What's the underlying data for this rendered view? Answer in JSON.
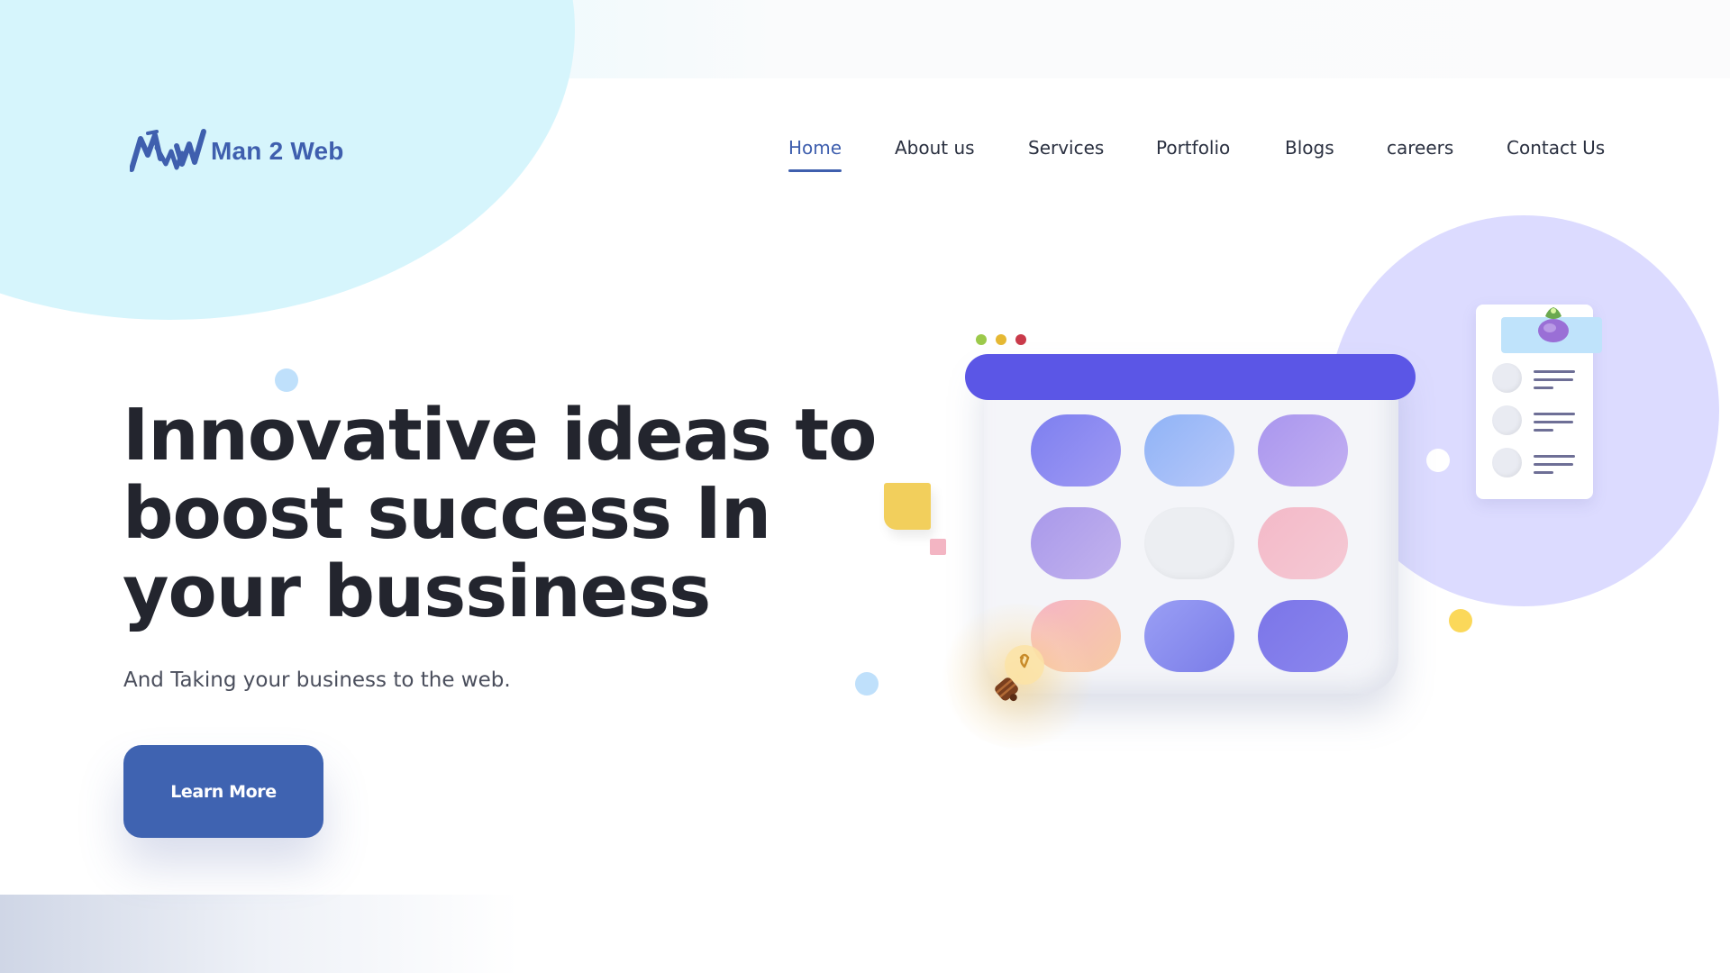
{
  "brand": {
    "name": "Man 2 Web",
    "accent": "#3f5fae"
  },
  "nav": {
    "items": [
      {
        "label": "Home",
        "active": true
      },
      {
        "label": "About us",
        "active": false
      },
      {
        "label": "Services",
        "active": false
      },
      {
        "label": "Portfolio",
        "active": false
      },
      {
        "label": "Blogs",
        "active": false
      },
      {
        "label": "careers",
        "active": false
      },
      {
        "label": "Contact Us",
        "active": false
      }
    ]
  },
  "hero": {
    "title_line_1": "Innovative ideas to",
    "title_line_2": "boost success In",
    "title_line_3": "your bussiness",
    "subtitle": "And Taking your business to the web.",
    "cta_label": "Learn More"
  },
  "colors": {
    "cta": "#3f63b1",
    "browser_bar": "#5b56e6",
    "lavender": "#dcdbff",
    "cyan": "#d6f5fc",
    "heading": "#23252e"
  },
  "icons": {
    "logo": "m2w-logo-icon",
    "illustration": "app-grid-browser-illustration",
    "bulb": "lightbulb-icon",
    "plant": "potted-plant-icon",
    "checklist": "checklist-icon",
    "sticky_note": "sticky-note-icon"
  }
}
